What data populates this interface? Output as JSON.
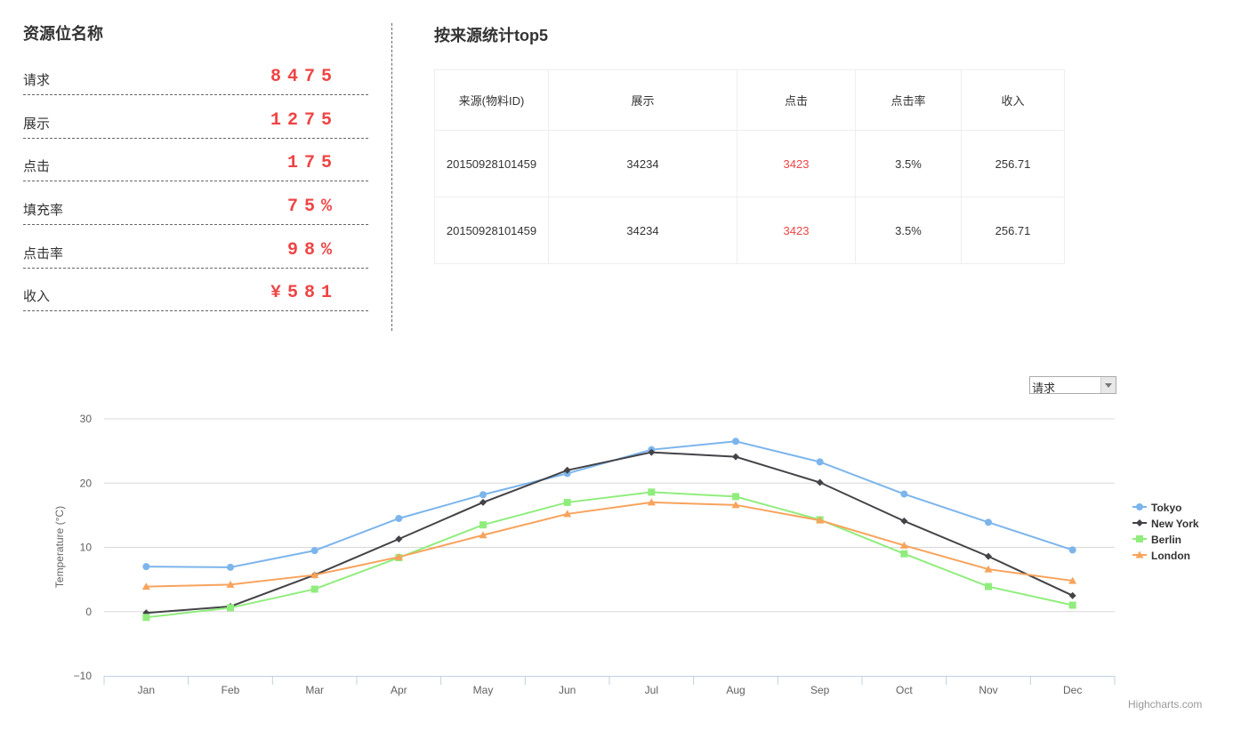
{
  "left_panel": {
    "title": "资源位名称",
    "stats": [
      {
        "label": "请求",
        "value": "8475"
      },
      {
        "label": "展示",
        "value": "1275"
      },
      {
        "label": "点击",
        "value": "175"
      },
      {
        "label": "填充率",
        "value": "75%"
      },
      {
        "label": "点击率",
        "value": "98%"
      },
      {
        "label": "收入",
        "value": "¥581"
      }
    ]
  },
  "right_panel": {
    "title": "按来源统计top5",
    "table": {
      "headers": [
        "来源(物料ID)",
        "展示",
        "点击",
        "点击率",
        "收入"
      ],
      "rows": [
        [
          "20150928101459",
          "34234",
          "3423",
          "3.5%",
          "256.71"
        ],
        [
          "20150928101459",
          "34234",
          "3423",
          "3.5%",
          "256.71"
        ]
      ]
    }
  },
  "chart_controls": {
    "metric_select": {
      "selected": "请求"
    }
  },
  "credits": "Highcharts.com",
  "colors": {
    "accent_red": "#ef4444"
  },
  "chart_data": {
    "type": "line",
    "categories": [
      "Jan",
      "Feb",
      "Mar",
      "Apr",
      "May",
      "Jun",
      "Jul",
      "Aug",
      "Sep",
      "Oct",
      "Nov",
      "Dec"
    ],
    "ylabel": "Temperature (°C)",
    "xlabel": "",
    "ylim": [
      -10,
      30
    ],
    "yticks": [
      -10,
      0,
      10,
      20,
      30
    ],
    "grid": true,
    "legend_position": "right",
    "series": [
      {
        "name": "Tokyo",
        "color": "#7cb5ec",
        "marker": "circle",
        "values": [
          7.0,
          6.9,
          9.5,
          14.5,
          18.2,
          21.5,
          25.2,
          26.5,
          23.3,
          18.3,
          13.9,
          9.6
        ]
      },
      {
        "name": "New York",
        "color": "#434348",
        "marker": "diamond",
        "values": [
          -0.2,
          0.8,
          5.7,
          11.3,
          17.0,
          22.0,
          24.8,
          24.1,
          20.1,
          14.1,
          8.6,
          2.5
        ]
      },
      {
        "name": "Berlin",
        "color": "#90ed7d",
        "marker": "square",
        "values": [
          -0.9,
          0.6,
          3.5,
          8.4,
          13.5,
          17.0,
          18.6,
          17.9,
          14.3,
          9.0,
          3.9,
          1.0
        ]
      },
      {
        "name": "London",
        "color": "#f7a35c",
        "marker": "triangle",
        "values": [
          3.9,
          4.2,
          5.7,
          8.5,
          11.9,
          15.2,
          17.0,
          16.6,
          14.2,
          10.3,
          6.6,
          4.8
        ]
      }
    ]
  }
}
